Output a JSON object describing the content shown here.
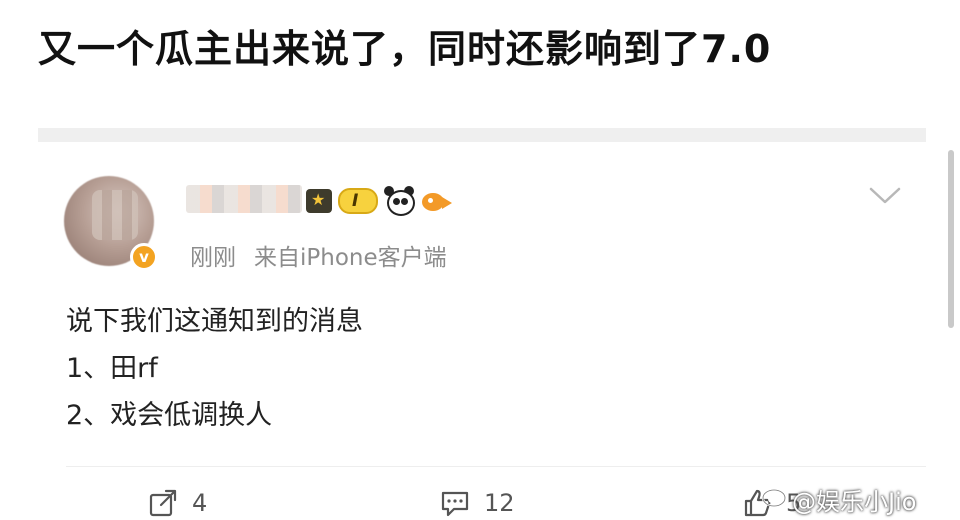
{
  "headline": "又一个瓜主出来说了，同时还影响到了7.0",
  "post": {
    "level_badge": "I",
    "verify_mark": "v",
    "meta": {
      "time": "刚刚",
      "source": "来自iPhone客户端"
    },
    "lines": [
      "说下我们这通知到的消息",
      "1、田rf",
      "2、戏会低调换人"
    ],
    "actions": {
      "share_count": "4",
      "comment_count": "12",
      "like_count": "5"
    }
  },
  "watermark": "@娱乐小Jio",
  "icons": {
    "share": "share-icon",
    "comment": "comment-icon",
    "like": "thumbs-up-icon",
    "menu": "chevron-down-icon"
  },
  "colors": {
    "verify_badge": "#f3a321",
    "level_badge": "#f7d23e",
    "meta_text": "#8c8c8c"
  }
}
